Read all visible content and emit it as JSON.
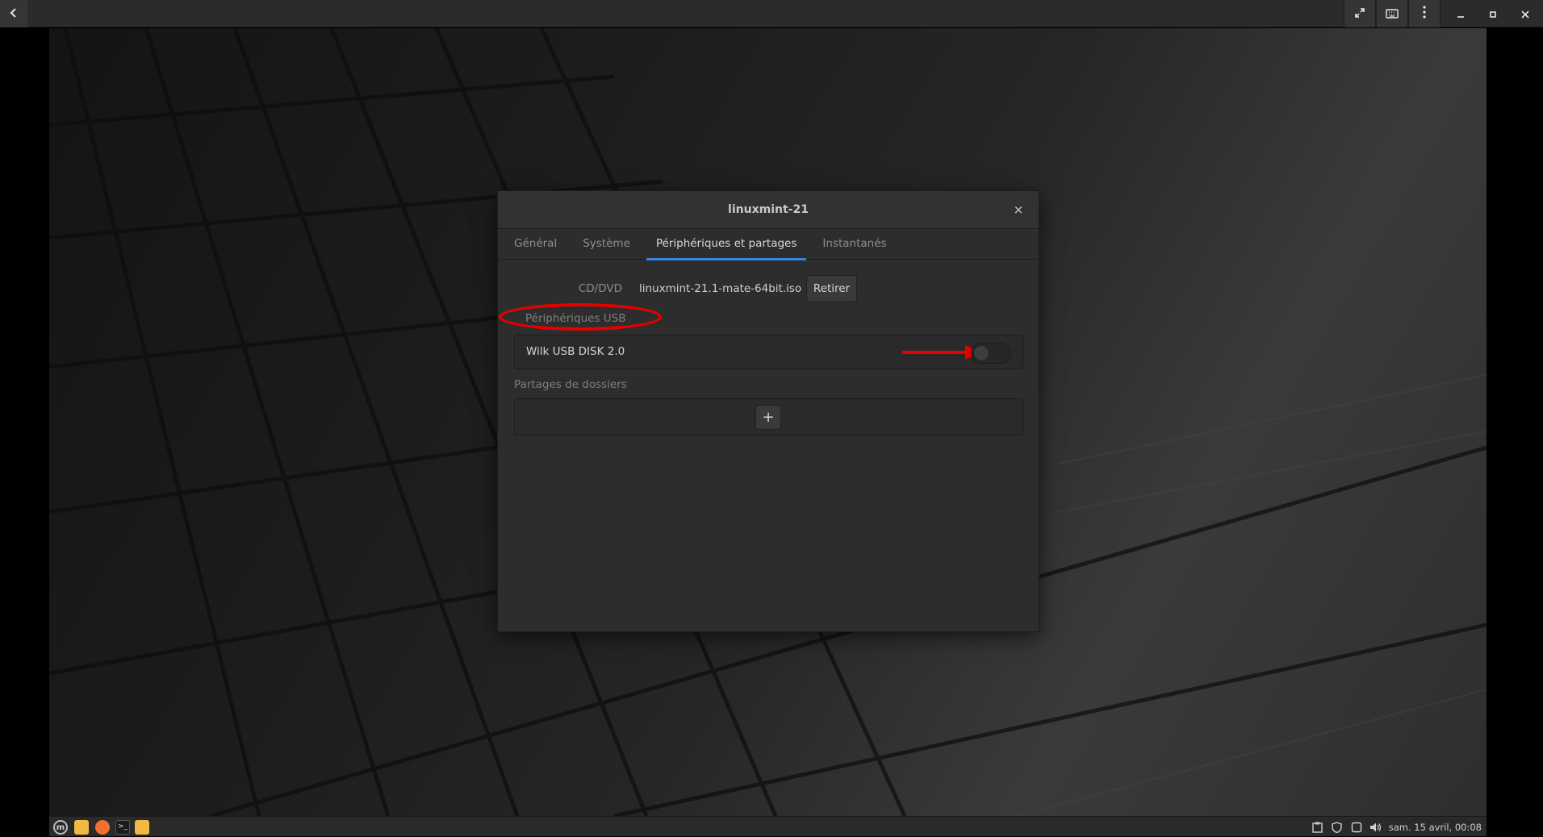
{
  "dialog": {
    "title": "linuxmint-21",
    "close_glyph": "×",
    "tabs": [
      {
        "label": "Général",
        "active": false
      },
      {
        "label": "Système",
        "active": false
      },
      {
        "label": "Périphériques et partages",
        "active": true
      },
      {
        "label": "Instantanés",
        "active": false
      }
    ],
    "cd_label": "CD/DVD",
    "cd_value": "linuxmint-21.1-mate-64bit.iso",
    "eject_label": "Retirer",
    "usb_heading": "Périphériques USB",
    "usb_devices": [
      {
        "name": "Wilk USB DISK 2.0",
        "enabled": false
      }
    ],
    "shares_heading": "Partages de dossiers",
    "add_share_glyph": "+"
  },
  "taskbar": {
    "clock": "sam. 15 avril, 00:08"
  },
  "annotations": {
    "color": "#e60000"
  },
  "icons": {
    "back": "back-arrow-icon",
    "fullscreen": "fullscreen-icon",
    "keyboard": "keyboard-icon",
    "menu": "kebab-menu-icon",
    "minimize": "minimize-icon",
    "maximize": "maximize-icon",
    "close": "close-icon"
  }
}
